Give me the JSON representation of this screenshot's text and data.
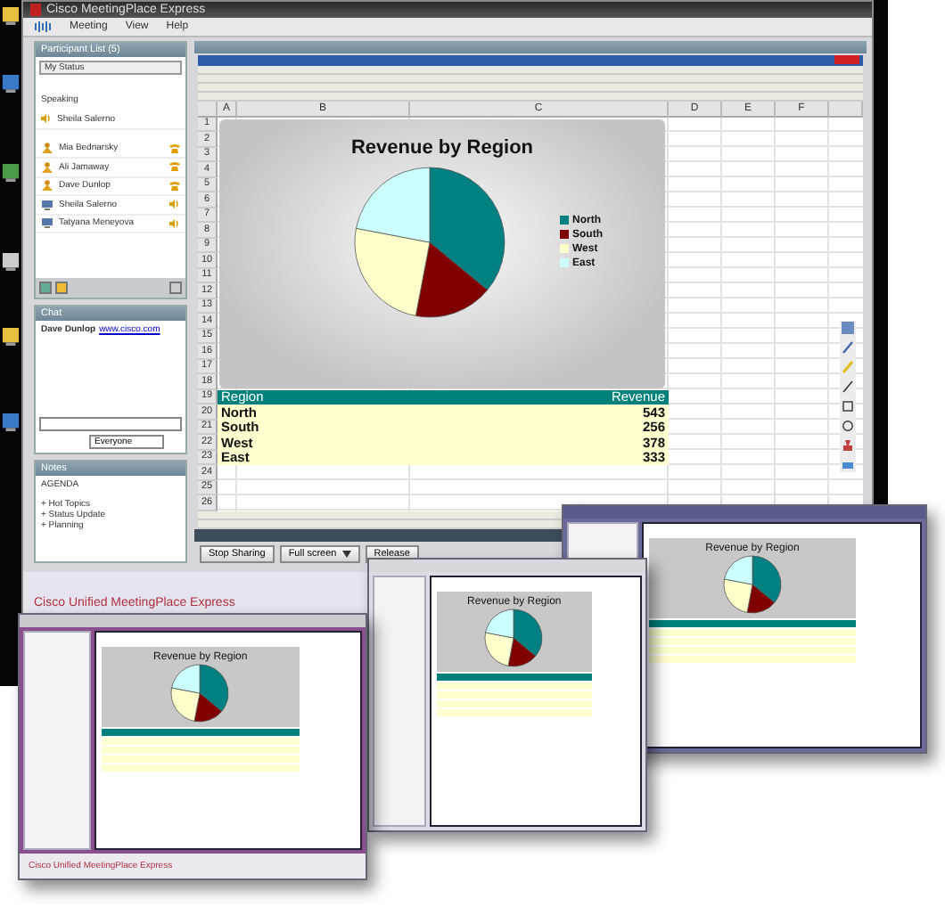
{
  "window": {
    "title": "Cisco MeetingPlace Express",
    "menu": [
      "Meeting",
      "View",
      "Help"
    ]
  },
  "participants": {
    "title": "Participant List (5)",
    "status": "My Status",
    "speaking_label": "Speaking",
    "speaker": "Sheila Salerno",
    "items": [
      {
        "name": "Mia Bednarsky",
        "kind": "phone"
      },
      {
        "name": "Ali Jamaway",
        "kind": "phone"
      },
      {
        "name": "Dave Dunlop",
        "kind": "phone"
      },
      {
        "name": "Sheila Salerno",
        "kind": "web"
      },
      {
        "name": "Tatyana Meneyova",
        "kind": "web"
      }
    ]
  },
  "chat": {
    "title": "Chat",
    "messages": [
      {
        "sender": "Dave Dunlop",
        "link": "www.cisco.com"
      }
    ],
    "to": "Everyone"
  },
  "notes": {
    "title": "Notes",
    "lines": [
      "AGENDA",
      "+ Hot Topics",
      "+ Status Update",
      "+ Planning"
    ]
  },
  "sharing": {
    "buttons": [
      {
        "label": "Stop Sharing",
        "kind": "plain"
      },
      {
        "label": "Full screen",
        "kind": "dropdown"
      },
      {
        "label": "Release",
        "kind": "plain"
      }
    ]
  },
  "footer": "Cisco Unified MeetingPlace Express",
  "spreadsheet": {
    "columns": [
      "A",
      "B",
      "C",
      "D",
      "E",
      "F"
    ],
    "row_numbers": [
      "1",
      "2",
      "3",
      "4",
      "5",
      "6",
      "7",
      "8",
      "9",
      "10",
      "11",
      "12",
      "13",
      "14",
      "15",
      "16",
      "17",
      "18",
      "19",
      "20",
      "21",
      "22",
      "23",
      "24",
      "25",
      "26"
    ],
    "table": {
      "header": [
        "Region",
        "Revenue"
      ],
      "rows": [
        [
          "North",
          "543"
        ],
        [
          "South",
          "256"
        ],
        [
          "West",
          "378"
        ],
        [
          "East",
          "333"
        ]
      ]
    },
    "chart_data": {
      "type": "pie",
      "title": "Revenue by Region",
      "legend": "right",
      "categories": [
        "North",
        "South",
        "West",
        "East"
      ],
      "colors": [
        "#008080",
        "#800000",
        "#ffffcc",
        "#ccffff"
      ],
      "series": [
        {
          "values": [
            36,
            17,
            25,
            22
          ]
        }
      ]
    }
  },
  "thumbnails": [
    {
      "kind": "linux",
      "chart_title": "Revenue by Region"
    },
    {
      "kind": "browser",
      "chart_title": "Revenue by Region"
    },
    {
      "kind": "mac",
      "chart_title": "Revenue by Region",
      "footer": "Cisco Unified MeetingPlace Express"
    }
  ]
}
